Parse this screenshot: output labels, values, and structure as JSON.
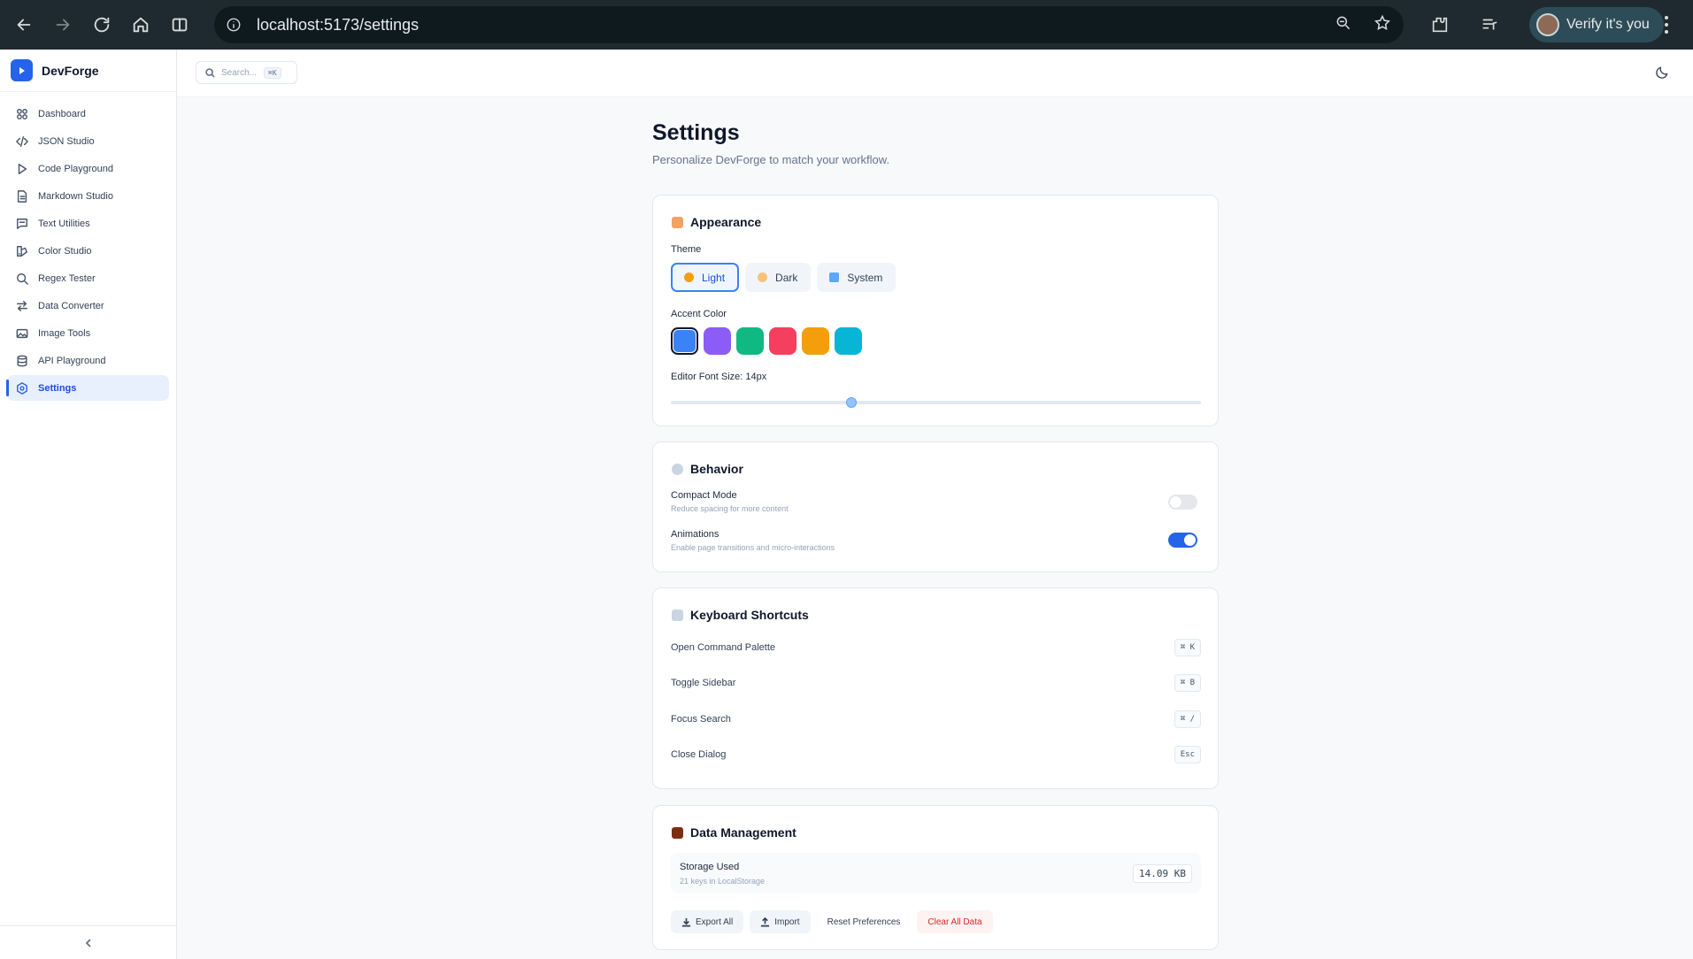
{
  "browser": {
    "url": "localhost:5173/settings",
    "profile_label": "Verify it's you"
  },
  "brand": {
    "name": "DevForge"
  },
  "sidebar": {
    "items": [
      {
        "label": "Dashboard",
        "icon": "grid-icon"
      },
      {
        "label": "JSON Studio",
        "icon": "code-icon"
      },
      {
        "label": "Code Playground",
        "icon": "play-icon"
      },
      {
        "label": "Markdown Studio",
        "icon": "file-text-icon"
      },
      {
        "label": "Text Utilities",
        "icon": "message-square-icon"
      },
      {
        "label": "Color Studio",
        "icon": "palette-icon"
      },
      {
        "label": "Regex Tester",
        "icon": "search-icon"
      },
      {
        "label": "Data Converter",
        "icon": "arrows-exchange-icon"
      },
      {
        "label": "Image Tools",
        "icon": "image-icon"
      },
      {
        "label": "API Playground",
        "icon": "database-icon"
      },
      {
        "label": "Settings",
        "icon": "settings-icon",
        "active": true
      }
    ]
  },
  "topbar": {
    "search_placeholder": "Search...",
    "search_shortcut": "⌘K"
  },
  "page": {
    "title": "Settings",
    "subtitle": "Personalize DevForge to match your workflow."
  },
  "appearance": {
    "title": "Appearance",
    "theme_label": "Theme",
    "themes": [
      {
        "label": "Light",
        "selected": true,
        "color": "#f59e0b"
      },
      {
        "label": "Dark",
        "selected": false,
        "color": "#f4c27a"
      },
      {
        "label": "System",
        "selected": false,
        "color": "#60a5fa"
      }
    ],
    "accent_label": "Accent Color",
    "accents": [
      "#3b82f6",
      "#8b5cf6",
      "#10b981",
      "#f43f5e",
      "#f59e0b",
      "#06b6d4"
    ],
    "accent_selected_index": 0,
    "font_size_label": "Editor Font Size: 14px",
    "font_size_fraction": 0.34
  },
  "behavior": {
    "title": "Behavior",
    "compact_title": "Compact Mode",
    "compact_desc": "Reduce spacing for more content",
    "compact_on": false,
    "anim_title": "Animations",
    "anim_desc": "Enable page transitions and micro-interactions",
    "anim_on": true
  },
  "shortcuts": {
    "title": "Keyboard Shortcuts",
    "rows": [
      {
        "label": "Open Command Palette",
        "keys": "⌘ K"
      },
      {
        "label": "Toggle Sidebar",
        "keys": "⌘ B"
      },
      {
        "label": "Focus Search",
        "keys": "⌘ /"
      },
      {
        "label": "Close Dialog",
        "keys": "Esc"
      }
    ]
  },
  "data": {
    "title": "Data Management",
    "storage_title": "Storage Used",
    "storage_desc": "21 keys in LocalStorage",
    "storage_value": "14.09 KB",
    "export_label": "Export All",
    "import_label": "Import",
    "reset_label": "Reset Preferences",
    "clear_label": "Clear All Data"
  },
  "colors": {
    "accent": "#2563eb",
    "danger": "#dc2626"
  }
}
